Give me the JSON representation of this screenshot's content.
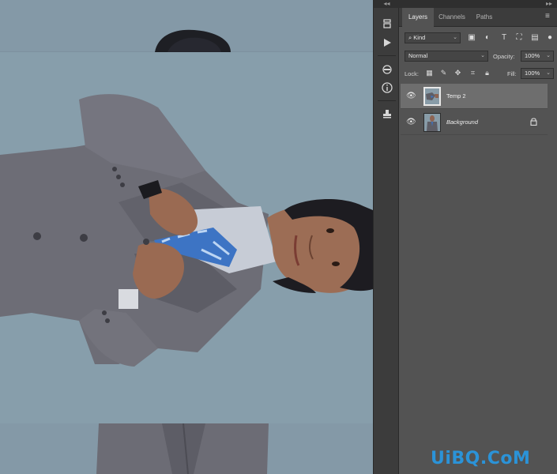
{
  "panel": {
    "collapse_left": "◂◂",
    "collapse_right": "▸▸",
    "tabs": [
      {
        "label": "Layers"
      },
      {
        "label": "Channels"
      },
      {
        "label": "Paths"
      }
    ],
    "menu_icon": "panel-menu-icon",
    "filter_dropdown": "Kind",
    "blend_mode": "Normal",
    "opacity_label": "Opacity:",
    "opacity_value": "100%",
    "lock_label": "Lock:",
    "fill_label": "Fill:",
    "fill_value": "100%",
    "layers": [
      {
        "name": "Temp 2",
        "selected": true
      },
      {
        "name": "Background",
        "selected": false,
        "locked": true
      }
    ]
  },
  "watermark": "UiBQ.CoM",
  "colors": {
    "panel_bg": "#535353",
    "strip_bg": "#3c3c3c",
    "canvas_bg": "#8499a7",
    "watermark": "#2b93d8",
    "selected_row": "#6e6e6e"
  }
}
